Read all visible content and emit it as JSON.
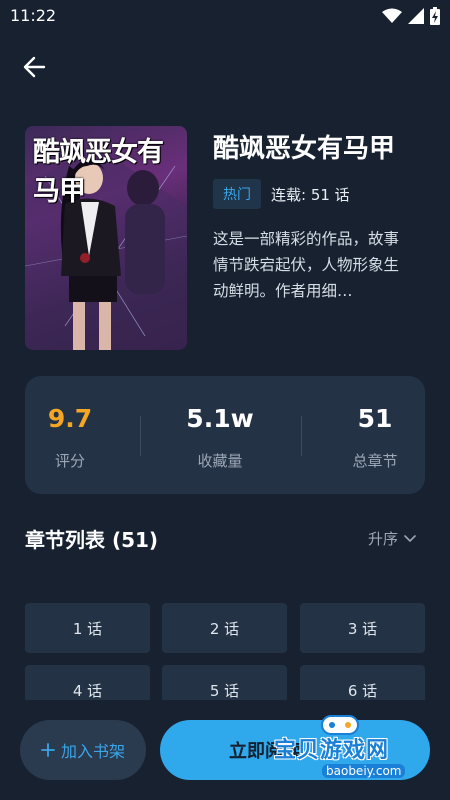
{
  "status_bar": {
    "time": "11:22"
  },
  "book": {
    "cover_title": "酷飒恶女有马甲",
    "title": "酷飒恶女有马甲",
    "badge": "热门",
    "serial": "连载: 51 话",
    "description": "这是一部精彩的作品，故事情节跌宕起伏，人物形象生动鲜明。作者用细…"
  },
  "stats": [
    {
      "value": "9.7",
      "label": "评分",
      "color": "#f5a623"
    },
    {
      "value": "5.1w",
      "label": "收藏量",
      "color": "#ffffff"
    },
    {
      "value": "51",
      "label": "总章节",
      "color": "#ffffff"
    }
  ],
  "chapters": {
    "section_title": "章节列表 (51)",
    "sort_label": "升序",
    "items": [
      "1 话",
      "2 话",
      "3 话",
      "4 话",
      "5 话",
      "6 话"
    ]
  },
  "bottom_bar": {
    "add_shelf_label": "加入书架",
    "read_label": "立即阅读"
  },
  "watermark": {
    "text": "宝贝游戏网",
    "sub": "baobeiy.com"
  },
  "colors": {
    "accent": "#2fa8ec",
    "score": "#f5a623",
    "background": "#172130",
    "card": "#243245"
  }
}
